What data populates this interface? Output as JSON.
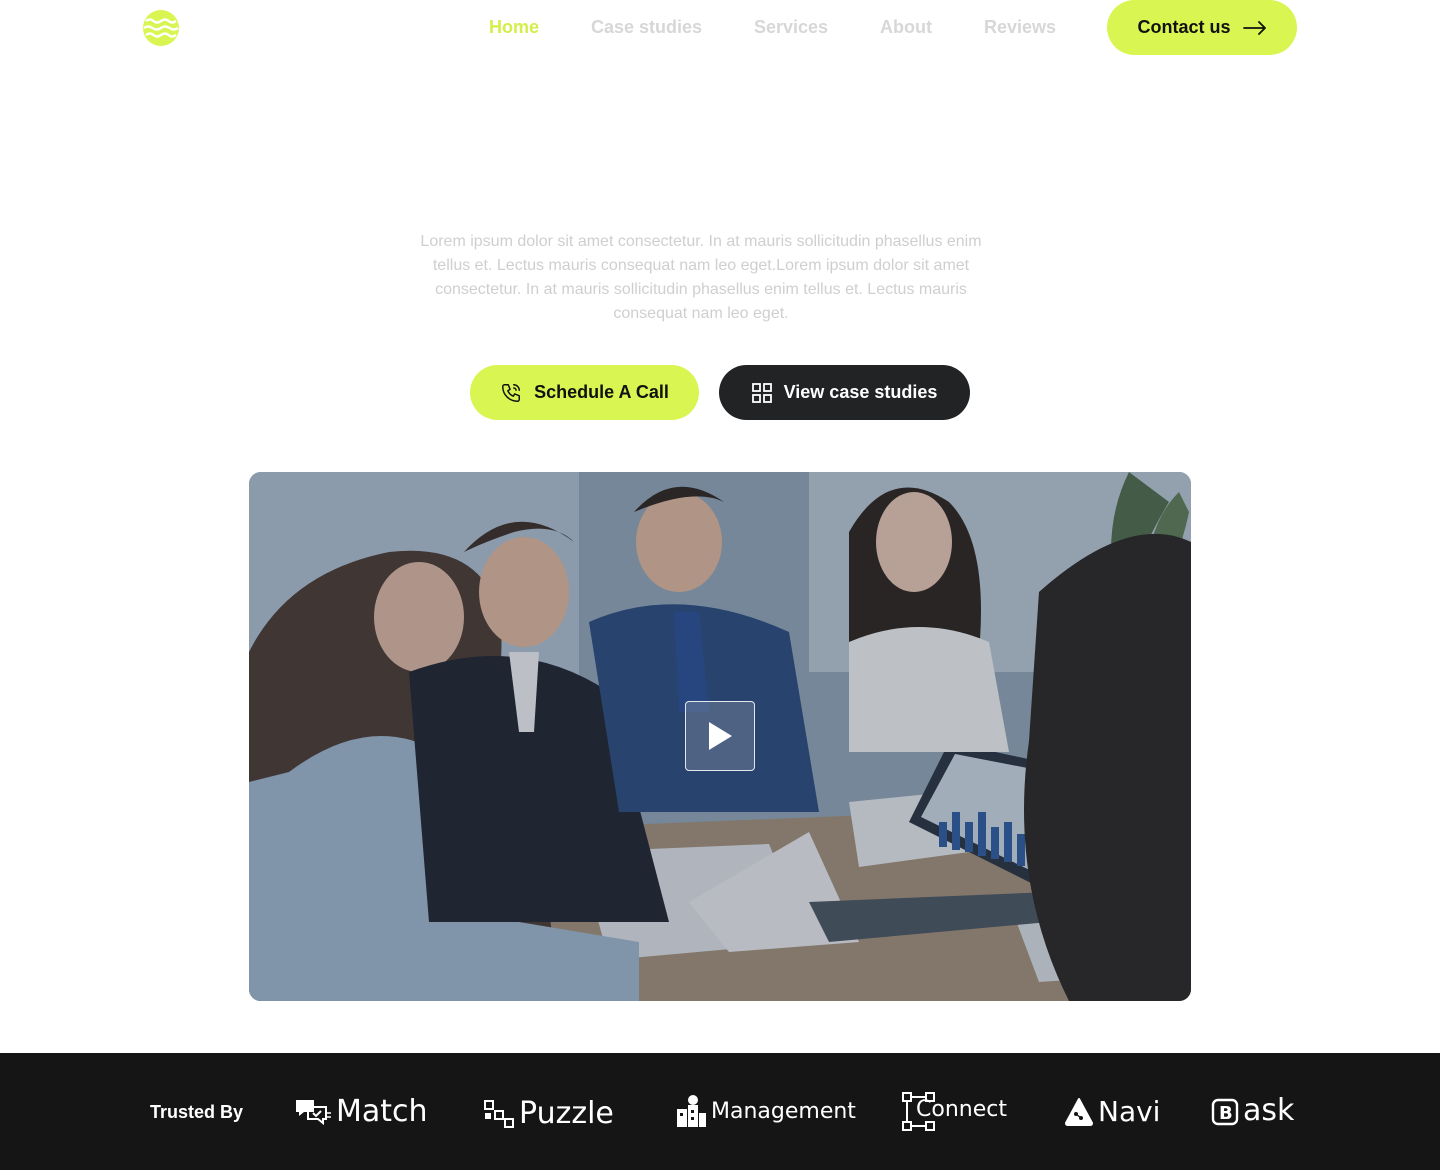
{
  "nav": {
    "items": [
      {
        "label": "Home",
        "active": true
      },
      {
        "label": "Case studies",
        "active": false
      },
      {
        "label": "Services",
        "active": false
      },
      {
        "label": "About",
        "active": false
      },
      {
        "label": "Reviews",
        "active": false
      }
    ],
    "contact_label": "Contact us",
    "logo_icon": "waves-logo-icon"
  },
  "hero": {
    "description": "Lorem ipsum dolor sit amet consectetur. In at mauris sollicitudin phasellus enim tellus et. Lectus mauris consequat nam leo eget.Lorem ipsum dolor sit amet consectetur. In at mauris sollicitudin phasellus enim tellus et. Lectus mauris consequat nam leo eget.",
    "primary_button": "Schedule A Call",
    "secondary_button": "View case studies"
  },
  "video": {
    "play_icon": "play-icon"
  },
  "trusted": {
    "label": "Trusted By",
    "brands": [
      "Match",
      "Puzzle",
      "Management",
      "Connect",
      "Navi",
      "ask"
    ]
  },
  "colors": {
    "accent": "#d9f551",
    "dark": "#222325",
    "muted_text": "#cfcfcf",
    "footer_bg": "#151515"
  }
}
